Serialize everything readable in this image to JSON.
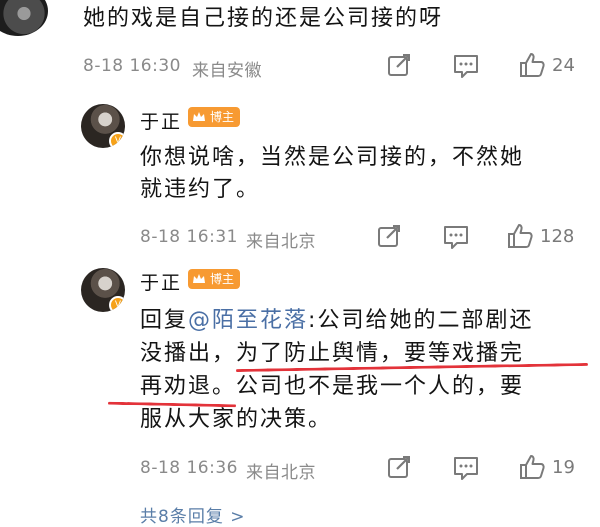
{
  "top_comment": {
    "text": "她的戏是自己接的还是公司接的呀",
    "date": "8-18 16:30",
    "location": "来自安徽",
    "like_count": "24"
  },
  "reply1": {
    "username": "于正",
    "badge": "博主",
    "text_line1": "你想说啥，当然是公司接的，不然她",
    "text_line2": "就违约了。",
    "date": "8-18 16:31",
    "location": "来自北京",
    "like_count": "128"
  },
  "reply2": {
    "username": "于正",
    "badge": "博主",
    "reply_prefix": "回复",
    "mention": "@陌至花落",
    "line1_rest": ":公司给她的二部剧还",
    "line2": "没播出，为了防止舆情，要等戏播完",
    "line3": "再劝退。公司也不是我一个人的，要",
    "line4": "服从大家的决策。",
    "date": "8-18 16:36",
    "location": "来自北京",
    "like_count": "19"
  },
  "more_replies": "共8条回复 >",
  "colors": {
    "accent_link": "#4a6fa5",
    "badge_bg": "#f79a32",
    "verified_badge": "#f6a21a",
    "underline": "#e3333a",
    "meta_gray": "#8a8a8a"
  },
  "icons": [
    "share-edit-icon",
    "comment-icon",
    "like-icon",
    "crown-icon",
    "verified-v-icon"
  ]
}
